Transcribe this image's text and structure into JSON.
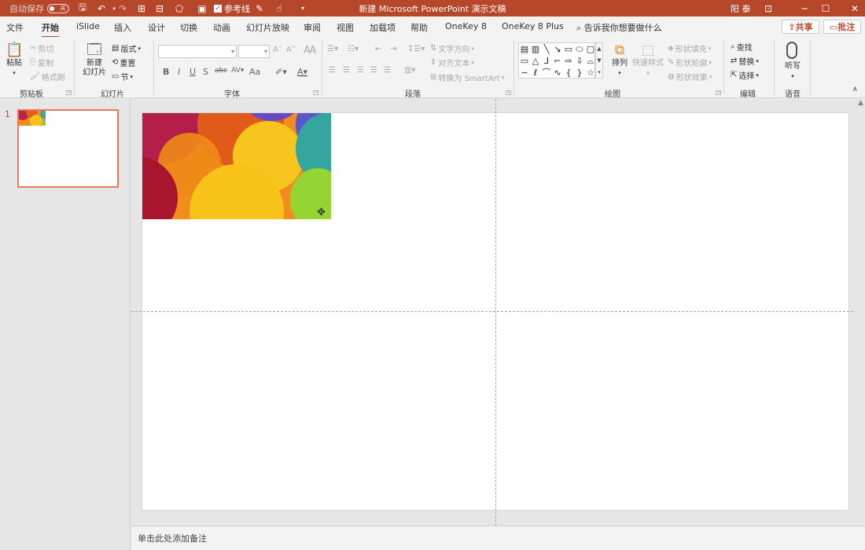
{
  "titlebar": {
    "autosave_label": "自动保存",
    "autosave_state": "关",
    "gridlines_label": "参考线",
    "document_title": "新建 Microsoft PowerPoint 演示文稿",
    "user_name": "阳 泰"
  },
  "tabs": [
    {
      "label": "文件"
    },
    {
      "label": "开始"
    },
    {
      "label": "iSlide"
    },
    {
      "label": "插入"
    },
    {
      "label": "设计"
    },
    {
      "label": "切换"
    },
    {
      "label": "动画"
    },
    {
      "label": "幻灯片放映"
    },
    {
      "label": "审阅"
    },
    {
      "label": "视图"
    },
    {
      "label": "加载项"
    },
    {
      "label": "帮助"
    },
    {
      "label": "OneKey 8"
    },
    {
      "label": "OneKey 8 Plus"
    }
  ],
  "tell_me": "告诉我你想要做什么",
  "share_label": "共享",
  "comment_label": "批注",
  "ribbon": {
    "clipboard": {
      "paste": "粘贴",
      "cut": "剪切",
      "copy": "复制",
      "format_painter": "格式刷",
      "label": "剪贴板"
    },
    "slides": {
      "new_slide_line1": "新建",
      "new_slide_line2": "幻灯片",
      "layout": "版式",
      "reset": "重置",
      "section": "节",
      "label": "幻灯片"
    },
    "font": {
      "label": "字体",
      "bold": "B",
      "italic": "I",
      "underline": "U",
      "shadow": "S",
      "strike": "abc",
      "case": "Aa"
    },
    "paragraph": {
      "text_direction": "文字方向",
      "align_text": "对齐文本",
      "smartart": "转换为 SmartArt",
      "label": "段落"
    },
    "drawing": {
      "arrange": "排列",
      "quick_styles": "快速样式",
      "shape_fill": "形状填充",
      "shape_outline": "形状轮廓",
      "shape_effects": "形状效果",
      "label": "绘图"
    },
    "editing": {
      "find": "查找",
      "replace": "替换",
      "select": "选择",
      "label": "编辑"
    },
    "voice": {
      "dictate": "听写",
      "label": "语音"
    }
  },
  "slides_panel": {
    "slide_number": "1"
  },
  "notes_placeholder": "单击此处添加备注",
  "colors": {
    "accent": "#b7472a",
    "ribbon_bg": "#f3f3f3",
    "thumb_border": "#e8795a"
  }
}
